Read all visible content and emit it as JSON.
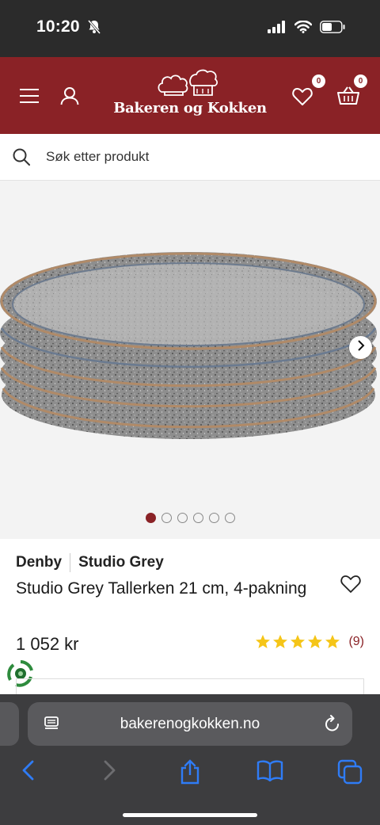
{
  "status": {
    "time": "10:20"
  },
  "header": {
    "logo_text": "Bakeren og Kokken",
    "wishlist_count": "0",
    "cart_count": "0"
  },
  "search": {
    "placeholder": "Søk etter produkt"
  },
  "gallery": {
    "image_count": 6,
    "active_index": 0
  },
  "product": {
    "brand": "Denby",
    "series": "Studio Grey",
    "title": "Studio Grey Tallerken 21 cm, 4-pakning",
    "price": "1 052 kr",
    "rating_stars": 5,
    "review_count": "(9)"
  },
  "browser": {
    "url": "bakerenogkokken.no"
  },
  "colors": {
    "brand_red": "#8a2226",
    "star": "#f5c518",
    "link_blue": "#2f7cf6"
  }
}
